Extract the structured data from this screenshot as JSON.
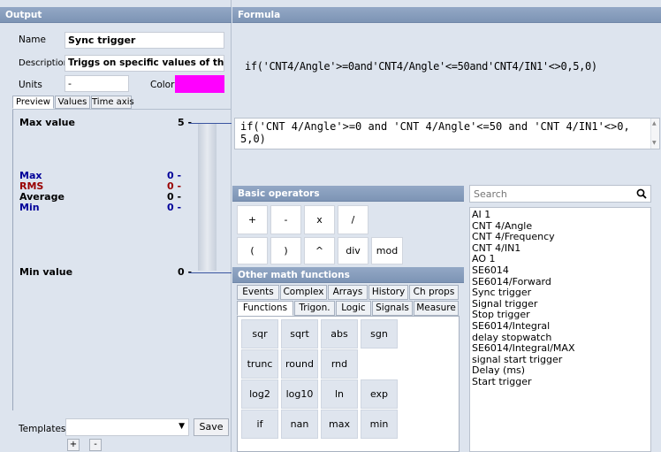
{
  "output": {
    "header": "Output",
    "name_label": "Name",
    "name_value": "Sync trigger",
    "description_label": "Description",
    "description_value": "Triggs on specific values of the ar",
    "units_label": "Units",
    "units_value": "-",
    "color_label": "Color",
    "color_value": "#ff00ff",
    "tabs": [
      "Preview",
      "Values",
      "Time axis"
    ],
    "max_value_label": "Max value",
    "max_value": "5 -",
    "min_value_label": "Min value",
    "min_value": "0 -",
    "stats": [
      {
        "label": "Max",
        "value": "0 -",
        "color": "#000099"
      },
      {
        "label": "RMS",
        "value": "0 -",
        "color": "#990000"
      },
      {
        "label": "Average",
        "value": "0 -",
        "color": "#000000"
      },
      {
        "label": "Min",
        "value": "0 -",
        "color": "#000099"
      }
    ],
    "templates_label": "Templates",
    "templates_value": "",
    "save_label": "Save",
    "add_label": "+",
    "remove_label": "-"
  },
  "formula": {
    "header": "Formula",
    "display": "if('CNT4/Angle'>=0and'CNT4/Angle'<=50and'CNT4/IN1'<>0,5,0)",
    "editor_text": "if('CNT 4/Angle'>=0 and 'CNT 4/Angle'<=50 and 'CNT 4/IN1'<>0,5,0)"
  },
  "basic_operators": {
    "header": "Basic operators",
    "row1": [
      "+",
      "-",
      "x",
      "/"
    ],
    "row2": [
      "(",
      ")",
      "^",
      "div",
      "mod"
    ]
  },
  "math_functions": {
    "header": "Other math functions",
    "tabs_row1": [
      "Events",
      "Complex",
      "Arrays",
      "History",
      "Ch props"
    ],
    "tabs_row2": [
      "Functions",
      "Trigon.",
      "Logic",
      "Signals",
      "Measure"
    ],
    "active_tab": "Functions",
    "rows": [
      [
        "sqr",
        "sqrt",
        "abs",
        "sgn"
      ],
      [
        "trunc",
        "round",
        "rnd"
      ],
      [
        "log2",
        "log10",
        "ln",
        "exp"
      ],
      [
        "if",
        "nan",
        "max",
        "min"
      ]
    ]
  },
  "channels": {
    "search_placeholder": "Search",
    "items": [
      "AI 1",
      "CNT 4/Angle",
      "CNT 4/Frequency",
      "CNT 4/IN1",
      "AO 1",
      "SE6014",
      "SE6014/Forward",
      "Sync trigger",
      "Signal trigger",
      "Stop trigger",
      "SE6014/Integral",
      "delay stopwatch",
      "SE6014/Integral/MAX",
      "signal start trigger",
      "Delay (ms)",
      "Start trigger"
    ]
  }
}
